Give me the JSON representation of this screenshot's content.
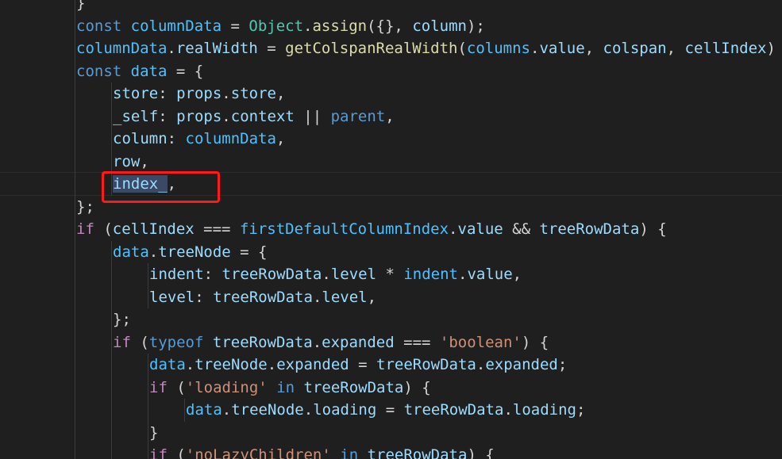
{
  "editor": {
    "colors": {
      "background": "#1f1f1f",
      "keyword": "#569cd6",
      "control": "#c586c0",
      "variable": "#9cdcfe",
      "constant": "#4fc1ff",
      "function": "#dcdcaa",
      "class": "#4ec9b0",
      "string": "#ce9178",
      "punctuation": "#d4d4d4",
      "annotation_box": "#ff1a1a"
    },
    "lines": [
      [
        {
          "t": "}",
          "c": "punctuation"
        }
      ],
      [
        {
          "t": "const",
          "c": "keyword"
        },
        {
          "t": " ",
          "c": "punctuation"
        },
        {
          "t": "columnData",
          "c": "constant"
        },
        {
          "t": " = ",
          "c": "punctuation"
        },
        {
          "t": "Object",
          "c": "class"
        },
        {
          "t": ".",
          "c": "punctuation"
        },
        {
          "t": "assign",
          "c": "function"
        },
        {
          "t": "({}, ",
          "c": "punctuation"
        },
        {
          "t": "column",
          "c": "variable"
        },
        {
          "t": ");",
          "c": "punctuation"
        }
      ],
      [
        {
          "t": "columnData",
          "c": "constant"
        },
        {
          "t": ".",
          "c": "punctuation"
        },
        {
          "t": "realWidth",
          "c": "variable"
        },
        {
          "t": " = ",
          "c": "punctuation"
        },
        {
          "t": "getColspanRealWidth",
          "c": "function"
        },
        {
          "t": "(",
          "c": "punctuation"
        },
        {
          "t": "columns",
          "c": "constant"
        },
        {
          "t": ".",
          "c": "punctuation"
        },
        {
          "t": "value",
          "c": "variable"
        },
        {
          "t": ", ",
          "c": "punctuation"
        },
        {
          "t": "colspan",
          "c": "variable"
        },
        {
          "t": ", ",
          "c": "punctuation"
        },
        {
          "t": "cellIndex",
          "c": "variable"
        },
        {
          "t": ")",
          "c": "punctuation"
        }
      ],
      [
        {
          "t": "const",
          "c": "keyword"
        },
        {
          "t": " ",
          "c": "punctuation"
        },
        {
          "t": "data",
          "c": "constant"
        },
        {
          "t": " = {",
          "c": "punctuation"
        }
      ],
      [
        {
          "t": "store",
          "c": "variable"
        },
        {
          "t": ": ",
          "c": "punctuation"
        },
        {
          "t": "props",
          "c": "variable"
        },
        {
          "t": ".",
          "c": "punctuation"
        },
        {
          "t": "store",
          "c": "variable"
        },
        {
          "t": ",",
          "c": "punctuation"
        }
      ],
      [
        {
          "t": "_self",
          "c": "variable"
        },
        {
          "t": ": ",
          "c": "punctuation"
        },
        {
          "t": "props",
          "c": "variable"
        },
        {
          "t": ".",
          "c": "punctuation"
        },
        {
          "t": "context",
          "c": "variable"
        },
        {
          "t": " || ",
          "c": "punctuation"
        },
        {
          "t": "parent",
          "c": "keyword"
        },
        {
          "t": ",",
          "c": "punctuation"
        }
      ],
      [
        {
          "t": "column",
          "c": "variable"
        },
        {
          "t": ": ",
          "c": "punctuation"
        },
        {
          "t": "columnData",
          "c": "constant"
        },
        {
          "t": ",",
          "c": "punctuation"
        }
      ],
      [
        {
          "t": "row",
          "c": "variable"
        },
        {
          "t": ",",
          "c": "punctuation"
        }
      ],
      [
        {
          "t": "index_",
          "c": "variable",
          "hl": true
        },
        {
          "t": ",",
          "c": "punctuation"
        }
      ],
      [
        {
          "t": "};",
          "c": "punctuation"
        }
      ],
      [
        {
          "t": "if",
          "c": "control"
        },
        {
          "t": " (",
          "c": "punctuation"
        },
        {
          "t": "cellIndex",
          "c": "variable"
        },
        {
          "t": " === ",
          "c": "punctuation"
        },
        {
          "t": "firstDefaultColumnIndex",
          "c": "constant"
        },
        {
          "t": ".",
          "c": "punctuation"
        },
        {
          "t": "value",
          "c": "variable"
        },
        {
          "t": " && ",
          "c": "punctuation"
        },
        {
          "t": "treeRowData",
          "c": "variable"
        },
        {
          "t": ") {",
          "c": "punctuation"
        }
      ],
      [
        {
          "t": "data",
          "c": "constant"
        },
        {
          "t": ".",
          "c": "punctuation"
        },
        {
          "t": "treeNode",
          "c": "variable"
        },
        {
          "t": " = {",
          "c": "punctuation"
        }
      ],
      [
        {
          "t": "indent",
          "c": "variable"
        },
        {
          "t": ": ",
          "c": "punctuation"
        },
        {
          "t": "treeRowData",
          "c": "variable"
        },
        {
          "t": ".",
          "c": "punctuation"
        },
        {
          "t": "level",
          "c": "variable"
        },
        {
          "t": " * ",
          "c": "punctuation"
        },
        {
          "t": "indent",
          "c": "constant"
        },
        {
          "t": ".",
          "c": "punctuation"
        },
        {
          "t": "value",
          "c": "variable"
        },
        {
          "t": ",",
          "c": "punctuation"
        }
      ],
      [
        {
          "t": "level",
          "c": "variable"
        },
        {
          "t": ": ",
          "c": "punctuation"
        },
        {
          "t": "treeRowData",
          "c": "variable"
        },
        {
          "t": ".",
          "c": "punctuation"
        },
        {
          "t": "level",
          "c": "variable"
        },
        {
          "t": ",",
          "c": "punctuation"
        }
      ],
      [
        {
          "t": "};",
          "c": "punctuation"
        }
      ],
      [
        {
          "t": "if",
          "c": "control"
        },
        {
          "t": " (",
          "c": "punctuation"
        },
        {
          "t": "typeof",
          "c": "keyword"
        },
        {
          "t": " ",
          "c": "punctuation"
        },
        {
          "t": "treeRowData",
          "c": "variable"
        },
        {
          "t": ".",
          "c": "punctuation"
        },
        {
          "t": "expanded",
          "c": "variable"
        },
        {
          "t": " === ",
          "c": "punctuation"
        },
        {
          "t": "'boolean'",
          "c": "string"
        },
        {
          "t": ") {",
          "c": "punctuation"
        }
      ],
      [
        {
          "t": "data",
          "c": "constant"
        },
        {
          "t": ".",
          "c": "punctuation"
        },
        {
          "t": "treeNode",
          "c": "variable"
        },
        {
          "t": ".",
          "c": "punctuation"
        },
        {
          "t": "expanded",
          "c": "variable"
        },
        {
          "t": " = ",
          "c": "punctuation"
        },
        {
          "t": "treeRowData",
          "c": "variable"
        },
        {
          "t": ".",
          "c": "punctuation"
        },
        {
          "t": "expanded",
          "c": "variable"
        },
        {
          "t": ";",
          "c": "punctuation"
        }
      ],
      [
        {
          "t": "if",
          "c": "control"
        },
        {
          "t": " (",
          "c": "punctuation"
        },
        {
          "t": "'loading'",
          "c": "string"
        },
        {
          "t": " ",
          "c": "punctuation"
        },
        {
          "t": "in",
          "c": "keyword"
        },
        {
          "t": " ",
          "c": "punctuation"
        },
        {
          "t": "treeRowData",
          "c": "variable"
        },
        {
          "t": ") {",
          "c": "punctuation"
        }
      ],
      [
        {
          "t": "data",
          "c": "constant"
        },
        {
          "t": ".",
          "c": "punctuation"
        },
        {
          "t": "treeNode",
          "c": "variable"
        },
        {
          "t": ".",
          "c": "punctuation"
        },
        {
          "t": "loading",
          "c": "variable"
        },
        {
          "t": " = ",
          "c": "punctuation"
        },
        {
          "t": "treeRowData",
          "c": "variable"
        },
        {
          "t": ".",
          "c": "punctuation"
        },
        {
          "t": "loading",
          "c": "variable"
        },
        {
          "t": ";",
          "c": "punctuation"
        }
      ],
      [
        {
          "t": "}",
          "c": "punctuation"
        }
      ],
      [
        {
          "t": "if",
          "c": "control"
        },
        {
          "t": " (",
          "c": "punctuation"
        },
        {
          "t": "'noLazyChildren'",
          "c": "string"
        },
        {
          "t": " ",
          "c": "punctuation"
        },
        {
          "t": "in",
          "c": "keyword"
        },
        {
          "t": " ",
          "c": "punctuation"
        },
        {
          "t": "treeRowData",
          "c": "variable"
        },
        {
          "t": ") {",
          "c": "punctuation"
        }
      ]
    ]
  }
}
